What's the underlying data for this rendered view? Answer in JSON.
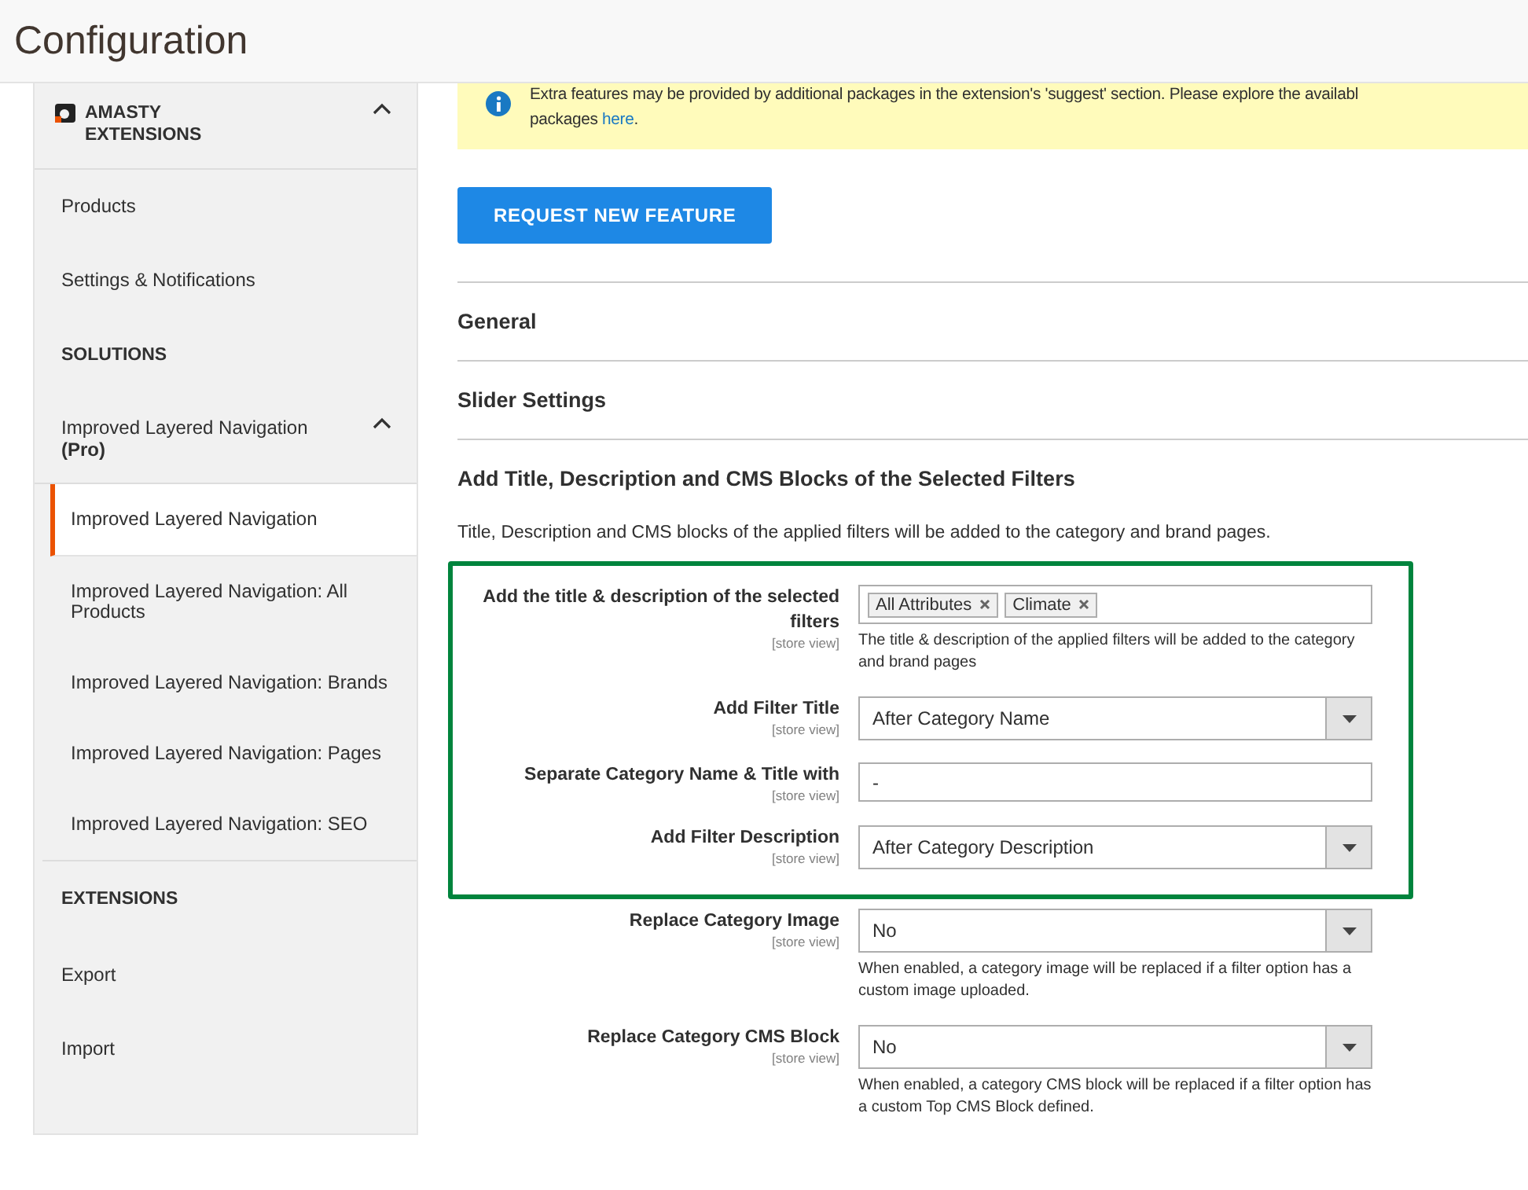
{
  "page_title": "Configuration",
  "sidebar": {
    "vendor": {
      "title": "AMASTY EXTENSIONS",
      "expanded": true
    },
    "items": [
      {
        "kind": "link",
        "label": "Products"
      },
      {
        "kind": "link",
        "label": "Settings & Notifications"
      },
      {
        "kind": "heading",
        "label": "SOLUTIONS"
      },
      {
        "kind": "group",
        "label": "Improved Layered Navigation (Pro)",
        "expanded": true,
        "children": [
          {
            "label": "Improved Layered Navigation",
            "selected": true
          },
          {
            "label": "Improved Layered Navigation: All Products",
            "selected": false
          },
          {
            "label": "Improved Layered Navigation: Brands",
            "selected": false
          },
          {
            "label": "Improved Layered Navigation: Pages",
            "selected": false
          },
          {
            "label": "Improved Layered Navigation: SEO",
            "selected": false
          }
        ]
      },
      {
        "kind": "heading",
        "label": "EXTENSIONS"
      },
      {
        "kind": "link",
        "label": "Export"
      },
      {
        "kind": "link",
        "label": "Import"
      }
    ]
  },
  "notice": {
    "line_1": "Extra features may be provided by additional packages in the extension's 'suggest' section. Please explore the availabl",
    "line_2": "packages ",
    "link": "here",
    "line_2_end": "."
  },
  "request_button": "REQUEST NEW FEATURE",
  "sections": [
    {
      "title": "General",
      "expanded": false
    },
    {
      "title": "Slider Settings",
      "expanded": false
    },
    {
      "title": "Add Title, Description and CMS Blocks of the Selected Filters",
      "expanded": true,
      "description": "Title, Description and CMS blocks of the applied filters will be added to the category and brand pages.",
      "fields": [
        {
          "kind": "multiselect",
          "label": "Add the title & description of the selected filters",
          "scope": "[store view]",
          "tags": [
            "All Attributes",
            "Climate"
          ],
          "note": "The title & description of the applied filters will be added to the category and brand pages",
          "highlighted": true
        },
        {
          "kind": "select",
          "label": "Add Filter Title",
          "scope": "[store view]",
          "value": "After Category Name",
          "highlighted": true
        },
        {
          "kind": "text",
          "label": "Separate Category Name & Title with",
          "scope": "[store view]",
          "value": "-",
          "highlighted": true
        },
        {
          "kind": "select",
          "label": "Add Filter Description",
          "scope": "[store view]",
          "value": "After Category Description",
          "highlighted": true
        },
        {
          "kind": "select",
          "label": "Replace Category Image",
          "scope": "[store view]",
          "value": "No",
          "note": "When enabled, a category image will be replaced if a filter option has a custom image uploaded.",
          "highlighted": false
        },
        {
          "kind": "select",
          "label": "Replace Category CMS Block",
          "scope": "[store view]",
          "value": "No",
          "note": "When enabled, a category CMS block will be replaced if a filter option has a custom Top CMS Block defined.",
          "highlighted": false
        }
      ]
    }
  ]
}
